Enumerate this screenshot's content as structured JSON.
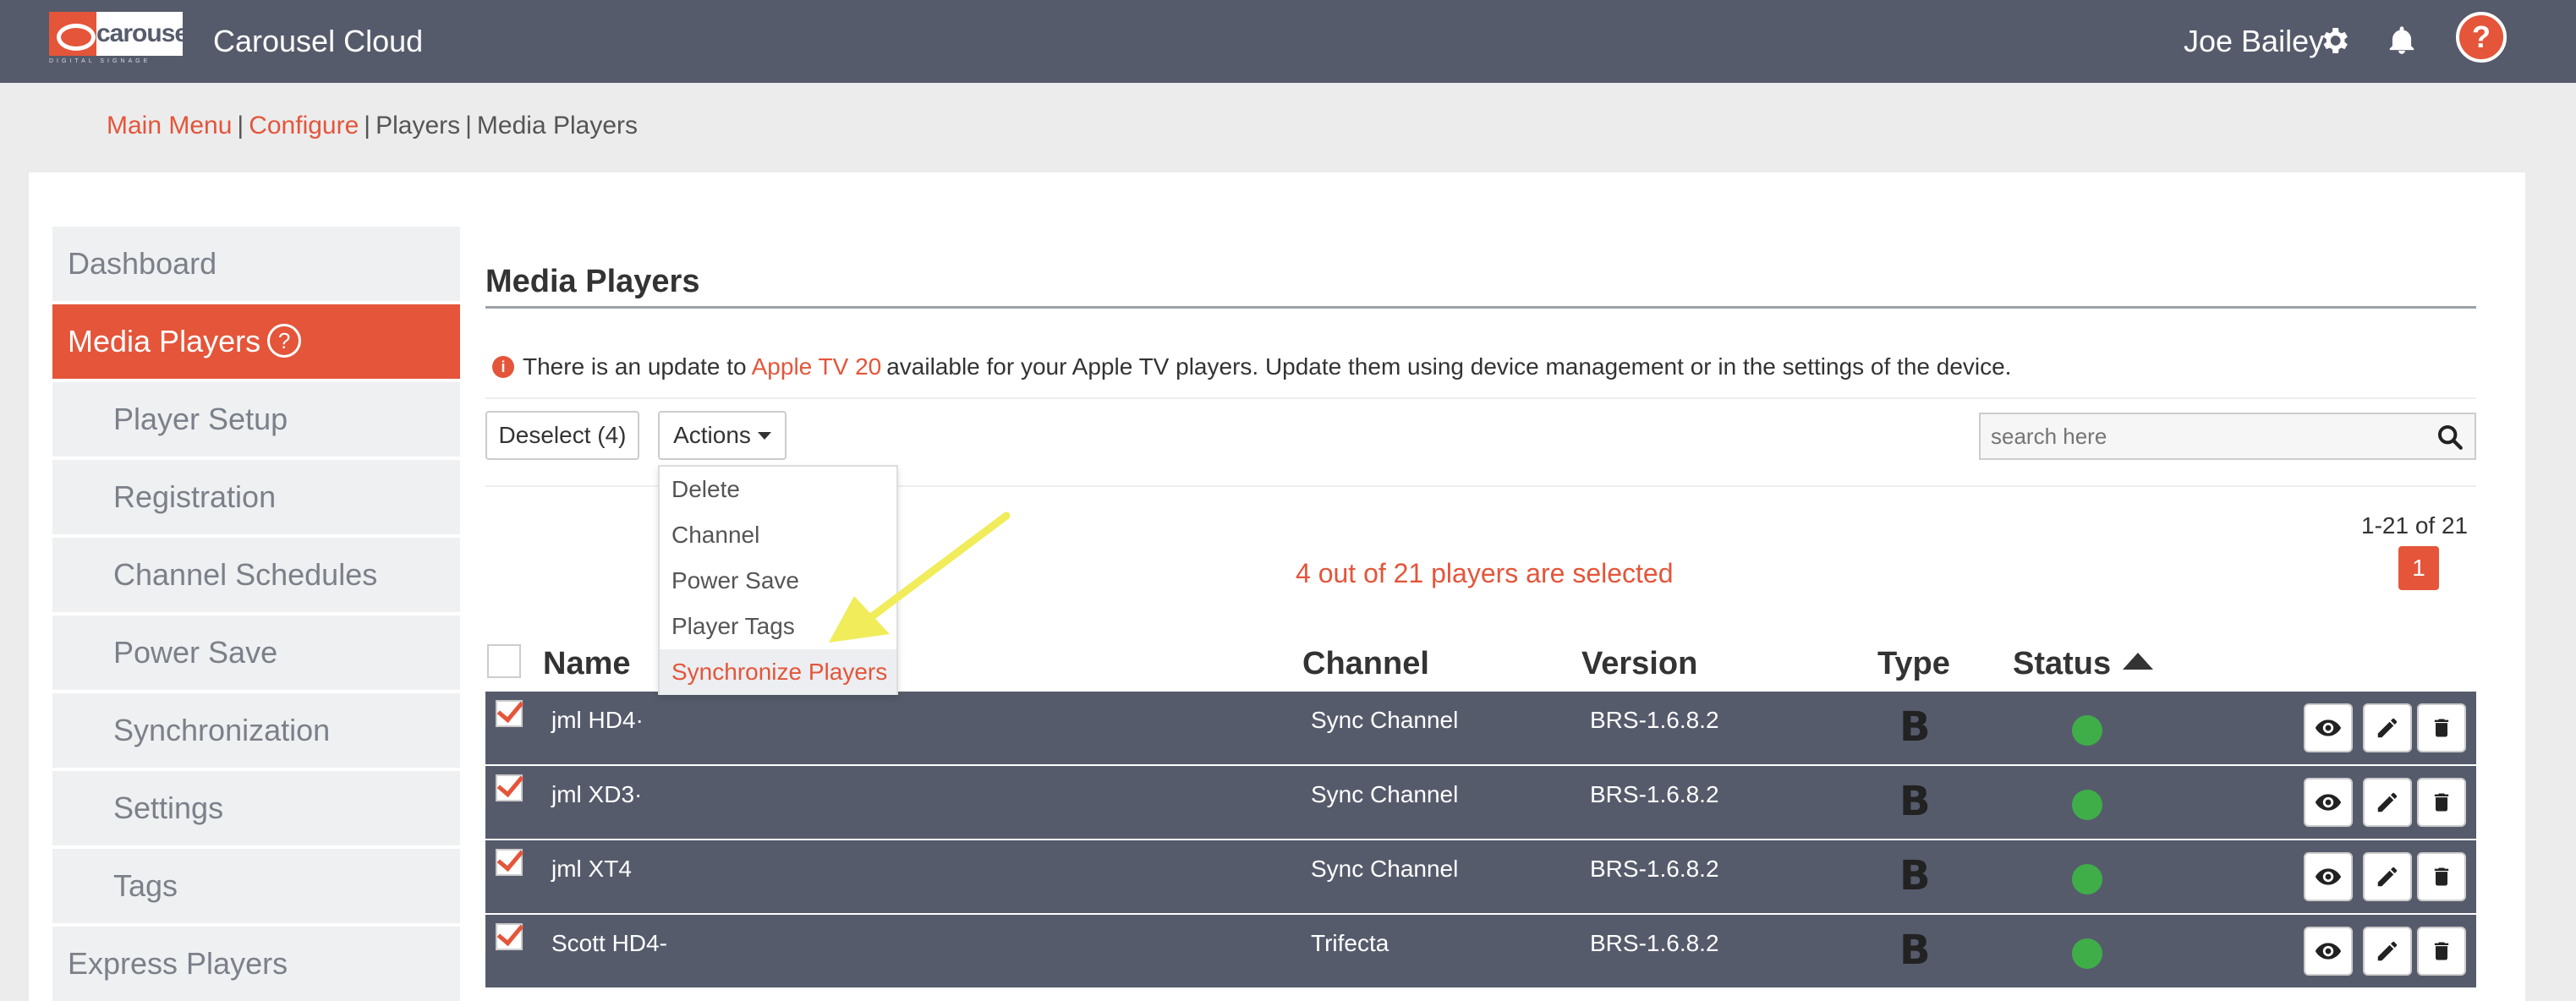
{
  "header": {
    "logo_word": "carousel",
    "logo_sub": "DIGITAL SIGNAGE",
    "app_title": "Carousel Cloud",
    "user_name": "Joe Bailey",
    "help_label": "?"
  },
  "breadcrumb": {
    "main_menu": "Main Menu",
    "configure": "Configure",
    "players": "Players",
    "media_players": "Media Players",
    "sep": "|"
  },
  "sidebar": {
    "items": [
      {
        "label": "Dashboard"
      },
      {
        "label": "Media Players",
        "help": "?"
      },
      {
        "label": "Player Setup"
      },
      {
        "label": "Registration"
      },
      {
        "label": "Channel Schedules"
      },
      {
        "label": "Power Save"
      },
      {
        "label": "Synchronization"
      },
      {
        "label": "Settings"
      },
      {
        "label": "Tags"
      },
      {
        "label": "Express Players"
      }
    ]
  },
  "main": {
    "title": "Media Players",
    "notice": {
      "pre": "There is an update to",
      "link": "Apple TV 20",
      "post": "available for your Apple TV players. Update them using device management or in the settings of the device."
    },
    "toolbar": {
      "deselect_label": "Deselect (4)",
      "actions_label": "Actions"
    },
    "search": {
      "placeholder": "search here"
    },
    "actions_menu": [
      "Delete",
      "Channel",
      "Power Save",
      "Player Tags",
      "Synchronize Players"
    ],
    "pager": {
      "range": "1-21 of 21",
      "current_page": "1"
    },
    "selected_message": "4 out of 21 players are selected",
    "table": {
      "columns": {
        "name": "Name",
        "channel": "Channel",
        "version": "Version",
        "type": "Type",
        "status": "Status"
      },
      "rows": [
        {
          "name": "jml HD4·",
          "channel": "Sync Channel",
          "version": "BRS-1.6.8.2",
          "type": "B"
        },
        {
          "name": "jml XD3·",
          "channel": "Sync Channel",
          "version": "BRS-1.6.8.2",
          "type": "B"
        },
        {
          "name": "jml XT4",
          "channel": "Sync Channel",
          "version": "BRS-1.6.8.2",
          "type": "B"
        },
        {
          "name": "Scott HD4-",
          "channel": "Trifecta",
          "version": "BRS-1.6.8.2",
          "type": "B"
        }
      ]
    }
  },
  "colors": {
    "brand_orange": "#e4553a",
    "topbar": "#565b6c",
    "status_online": "#3fae49",
    "arrow_annotation": "#f0ec5a"
  }
}
